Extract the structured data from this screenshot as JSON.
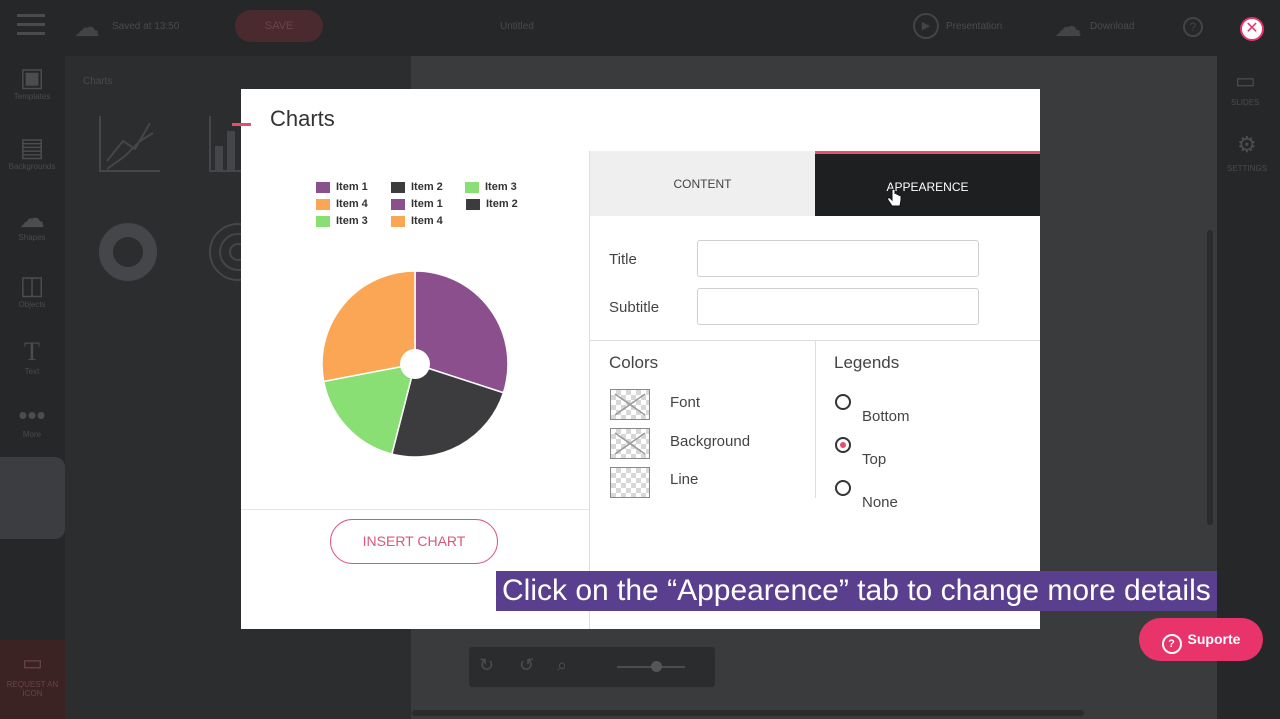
{
  "app": {
    "topbar": {
      "save_label": "SAVE",
      "status_text": "Saved at 13:50",
      "doc_name": "Untitled",
      "present_label": "Presentation",
      "download_label": "Download"
    },
    "sidebar": [
      "Templates",
      "Backgrounds",
      "Shapes",
      "Objects",
      "Text",
      "More"
    ],
    "request_label": "REQUEST AN ICON",
    "panel_title": "Charts",
    "rightbar": [
      "SLIDES",
      "SETTINGS"
    ]
  },
  "modal": {
    "title": "Charts",
    "legend": [
      {
        "label": "Item 1",
        "color": "#8b4f8e"
      },
      {
        "label": "Item 2",
        "color": "#3c3b3e"
      },
      {
        "label": "Item 3",
        "color": "#8adf74"
      },
      {
        "label": "Item 4",
        "color": "#fba654"
      },
      {
        "label": "Item 1",
        "color": "#8b4f8e"
      },
      {
        "label": "Item 2",
        "color": "#3c3b3e"
      },
      {
        "label": "Item 3",
        "color": "#8adf74"
      },
      {
        "label": "Item 4",
        "color": "#fba654"
      }
    ],
    "insert_button": "INSERT CHART",
    "tabs": {
      "content": "CONTENT",
      "appearence": "APPEARENCE"
    },
    "fields": {
      "title_label": "Title",
      "subtitle_label": "Subtitle",
      "title_value": "",
      "subtitle_value": ""
    },
    "colors": {
      "heading": "Colors",
      "items": [
        "Font",
        "Background",
        "Line"
      ]
    },
    "legends": {
      "heading": "Legends",
      "options": [
        "Bottom",
        "Top",
        "None"
      ],
      "selected": "Top"
    }
  },
  "chart_data": {
    "type": "pie",
    "categories": [
      "Item 1",
      "Item 2",
      "Item 3",
      "Item 4"
    ],
    "values": [
      30,
      24,
      18,
      28
    ],
    "colors": [
      "#8b4f8e",
      "#3c3b3e",
      "#8adf74",
      "#fba654"
    ]
  },
  "caption": "Click on the “Appearence” tab to change more details",
  "support_button": "Suporte",
  "accent": "#e84e6b"
}
